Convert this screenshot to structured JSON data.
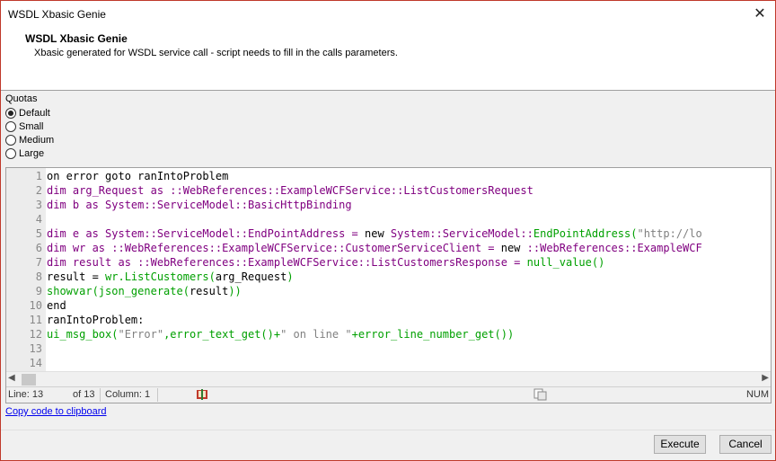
{
  "window": {
    "title": "WSDL Xbasic Genie",
    "close_glyph": "✕"
  },
  "header": {
    "title": "WSDL Xbasic Genie",
    "description": "Xbasic generated for WSDL service call - script needs to fill in the calls parameters."
  },
  "quotas": {
    "label": "Quotas",
    "options": [
      "Default",
      "Small",
      "Medium",
      "Large"
    ],
    "selected": "Default"
  },
  "code": {
    "lines": [
      {
        "n": "1",
        "parts": [
          [
            "on error goto ranIntoProblem",
            "blk"
          ]
        ]
      },
      {
        "n": "2",
        "parts": [
          [
            "dim arg_Request as ::WebReferences::ExampleWCFService::ListCustomersRequest",
            "kw"
          ]
        ]
      },
      {
        "n": "3",
        "parts": [
          [
            "dim b as System::ServiceModel::BasicHttpBinding",
            "kw"
          ]
        ]
      },
      {
        "n": "4",
        "parts": []
      },
      {
        "n": "5",
        "parts": [
          [
            "dim e as System::ServiceModel::EndPointAddress = ",
            "kw"
          ],
          [
            "new ",
            "blk"
          ],
          [
            "System::ServiceModel::",
            "kw"
          ],
          [
            "EndPointAddress(",
            "fn"
          ],
          [
            "\"http://lo",
            "str"
          ]
        ]
      },
      {
        "n": "6",
        "parts": [
          [
            "dim wr as ::WebReferences::ExampleWCFService::CustomerServiceClient = ",
            "kw"
          ],
          [
            "new ",
            "blk"
          ],
          [
            "::WebReferences::ExampleWCF",
            "kw"
          ]
        ]
      },
      {
        "n": "7",
        "parts": [
          [
            "dim result as ::WebReferences::ExampleWCFService::ListCustomersResponse = ",
            "kw"
          ],
          [
            "null_value()",
            "fn"
          ]
        ]
      },
      {
        "n": "8",
        "parts": [
          [
            "result = ",
            "blk"
          ],
          [
            "wr.ListCustomers(",
            "fn"
          ],
          [
            "arg_Request",
            "blk"
          ],
          [
            ")",
            "fn"
          ]
        ]
      },
      {
        "n": "9",
        "parts": [
          [
            "showvar(json_generate(",
            "fn"
          ],
          [
            "result",
            "blk"
          ],
          [
            "))",
            "fn"
          ]
        ]
      },
      {
        "n": "10",
        "parts": [
          [
            "end",
            "blk"
          ]
        ]
      },
      {
        "n": "11",
        "parts": [
          [
            "ranIntoProblem:",
            "blk"
          ]
        ]
      },
      {
        "n": "12",
        "parts": [
          [
            "ui_msg_box(",
            "fn"
          ],
          [
            "\"Error\"",
            "str"
          ],
          [
            ",error_text_get()+",
            "fn"
          ],
          [
            "\" on line \"",
            "str"
          ],
          [
            "+error_line_number_get())",
            "fn"
          ]
        ]
      },
      {
        "n": "13",
        "parts": []
      },
      {
        "n": "14",
        "parts": []
      }
    ]
  },
  "statusbar": {
    "line": "Line: 13",
    "of": "of 13",
    "column": "Column: 1",
    "num": "NUM"
  },
  "copy_link": "Copy code to clipboard",
  "buttons": {
    "execute": "Execute",
    "cancel": "Cancel"
  },
  "colors": {
    "keyword": "#800080",
    "function": "#00a000",
    "string": "#808080",
    "link": "#0000ee",
    "window_border": "#c0392b"
  }
}
